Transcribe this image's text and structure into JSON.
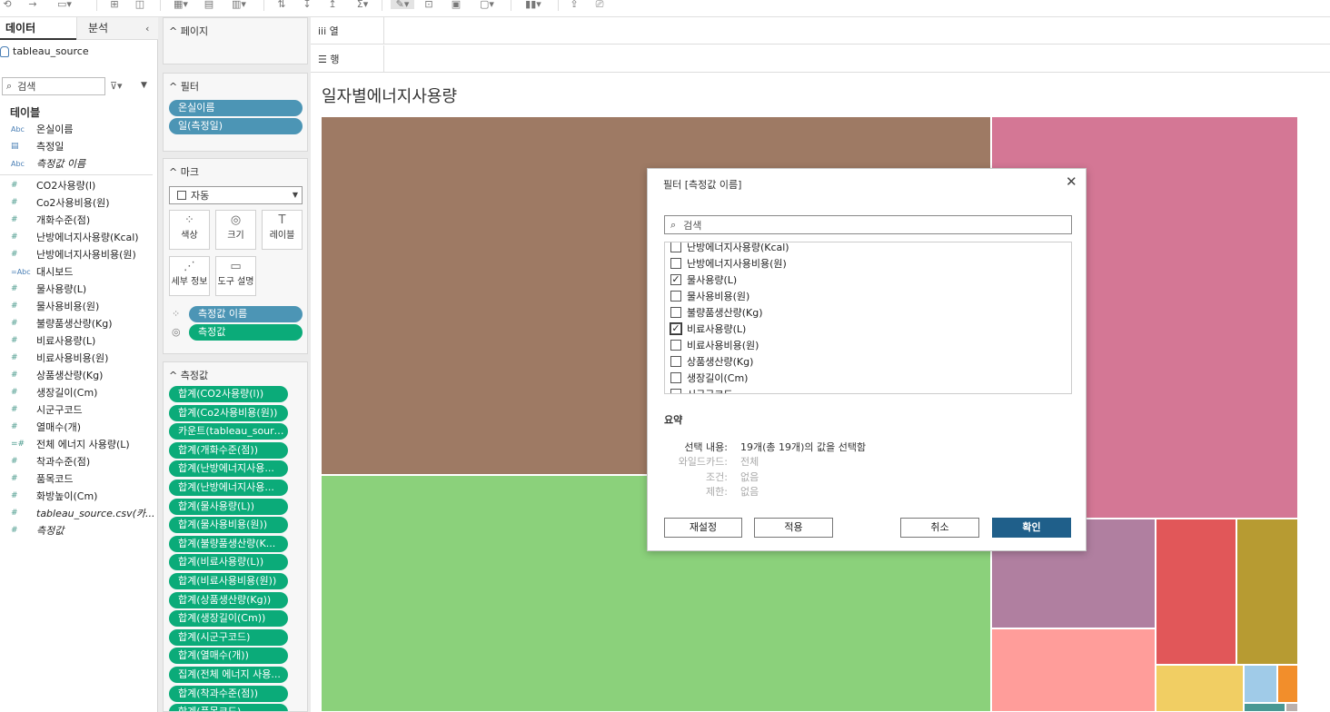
{
  "toolbar": {
    "icons": [
      "undo-icon",
      "redo-icon",
      "save-icon",
      "new-datasource-icon",
      "pause-updates-icon",
      "new-worksheet-icon",
      "duplicate-sheet-icon",
      "clear-sheet-icon",
      "swap-icon",
      "sort-ascending-icon",
      "sort-descending-icon",
      "totals-icon",
      "highlight-icon",
      "group-icon",
      "label-icon",
      "fit-icon",
      "show-me-icon",
      "share-icon",
      "present-icon"
    ]
  },
  "data_pane": {
    "tabs": [
      "데이터",
      "분석"
    ],
    "datasource": "tableau_source",
    "search_placeholder": "검색",
    "tables_heading": "테이블",
    "fields": [
      {
        "type": "abc",
        "name": "온실이름"
      },
      {
        "type": "date",
        "name": "측정일"
      },
      {
        "type": "abc",
        "name": "측정값 이름",
        "italic": true
      },
      {
        "type": "num",
        "name": "CO2사용량(l)"
      },
      {
        "type": "num",
        "name": "Co2사용비용(원)"
      },
      {
        "type": "num",
        "name": "개화수준(점)"
      },
      {
        "type": "num",
        "name": "난방에너지사용량(Kcal)"
      },
      {
        "type": "num",
        "name": "난방에너지사용비용(원)"
      },
      {
        "type": "calc-abc",
        "name": "대시보드"
      },
      {
        "type": "num",
        "name": "물사용량(L)"
      },
      {
        "type": "num",
        "name": "물사용비용(원)"
      },
      {
        "type": "num",
        "name": "불량품생산량(Kg)"
      },
      {
        "type": "num",
        "name": "비료사용량(L)"
      },
      {
        "type": "num",
        "name": "비료사용비용(원)"
      },
      {
        "type": "num",
        "name": "상품생산량(Kg)"
      },
      {
        "type": "num",
        "name": "생장길이(Cm)"
      },
      {
        "type": "num",
        "name": "시군구코드"
      },
      {
        "type": "num",
        "name": "열매수(개)"
      },
      {
        "type": "calc-num",
        "name": "전체 에너지 사용량(L)"
      },
      {
        "type": "num",
        "name": "착과수준(점)"
      },
      {
        "type": "num",
        "name": "품목코드"
      },
      {
        "type": "num",
        "name": "화방높이(Cm)"
      },
      {
        "type": "num",
        "name": "tableau_source.csv(카...",
        "italic": true
      },
      {
        "type": "num",
        "name": "측정값",
        "italic": true
      }
    ]
  },
  "shelves": {
    "pages_label": "페이지",
    "filters_label": "필터",
    "filter_pills": [
      "온실이름",
      "일(측정일)"
    ],
    "marks_label": "마크",
    "mark_type": "자동",
    "mark_buttons": [
      {
        "icon": "color-icon",
        "glyph": "⁘",
        "label": "색상"
      },
      {
        "icon": "size-icon",
        "glyph": "◎",
        "label": "크기"
      },
      {
        "icon": "label-icon",
        "glyph": "T",
        "label": "레이블"
      },
      {
        "icon": "detail-icon",
        "glyph": "⋰",
        "label": "세부 정보"
      },
      {
        "icon": "tooltip-icon",
        "glyph": "▭",
        "label": "도구 설명"
      }
    ],
    "mark_encodings": [
      {
        "icon": "color-icon",
        "glyph": "⁘",
        "pill": "측정값 이름",
        "color": "blue"
      },
      {
        "icon": "size-icon",
        "glyph": "◎",
        "pill": "측정값",
        "color": "green"
      }
    ],
    "measures_label": "측정값",
    "measure_pills": [
      "합계(CO2사용량(l))",
      "합계(Co2사용비용(원))",
      "카운트(tableau_source...",
      "합계(개화수준(점))",
      "합계(난방에너지사용...",
      "합계(난방에너지사용...",
      "합계(물사용량(L))",
      "합계(물사용비용(원))",
      "합계(불량품생산량(K...",
      "합계(비료사용량(L))",
      "합계(비료사용비용(원))",
      "합계(상품생산량(Kg))",
      "합계(생장길이(Cm))",
      "합계(시군구코드)",
      "합계(열매수(개))",
      "집계(전체 에너지 사용...",
      "합계(착과수준(점))",
      "합계(품목코드)"
    ]
  },
  "view": {
    "columns_label": "열",
    "rows_label": "행",
    "sheet_title": "일자별에너지사용량"
  },
  "treemap_colors": {
    "brown": "#9e7a64",
    "pink": "#d47795",
    "green": "#8bd17b",
    "purple": "#b07fa0",
    "red": "#e15759",
    "olive": "#b79b32",
    "salmon": "#ff9d9a",
    "yellow": "#f1ce63",
    "lightblue": "#a0cbe8",
    "orange": "#f28e2b",
    "teal": "#499894",
    "gray": "#bab0ac"
  },
  "filter_dialog": {
    "title": "필터 [측정값 이름]",
    "search_placeholder": "검색",
    "items": [
      {
        "label": "난방에너지사용량(Kcal)",
        "checked": false
      },
      {
        "label": "난방에너지사용비용(원)",
        "checked": false
      },
      {
        "label": "물사용량(L)",
        "checked": true
      },
      {
        "label": "물사용비용(원)",
        "checked": false
      },
      {
        "label": "불량품생산량(Kg)",
        "checked": false
      },
      {
        "label": "비료사용량(L)",
        "checked": true,
        "focused": true
      },
      {
        "label": "비료사용비용(원)",
        "checked": false
      },
      {
        "label": "상품생산량(Kg)",
        "checked": false
      },
      {
        "label": "생장길이(Cm)",
        "checked": false
      },
      {
        "label": "시군구코드",
        "checked": false
      }
    ],
    "summary_heading": "요약",
    "summary": {
      "selection_key": "선택 내용:",
      "selection_value": "19개(총 19개)의 값을 선택함",
      "wildcard_key": "와일드카드:",
      "wildcard_value": "전체",
      "condition_key": "조건:",
      "condition_value": "없음",
      "limit_key": "제한:",
      "limit_value": "없음"
    },
    "buttons": {
      "reset": "재설정",
      "apply": "적용",
      "cancel": "취소",
      "ok": "확인"
    }
  }
}
